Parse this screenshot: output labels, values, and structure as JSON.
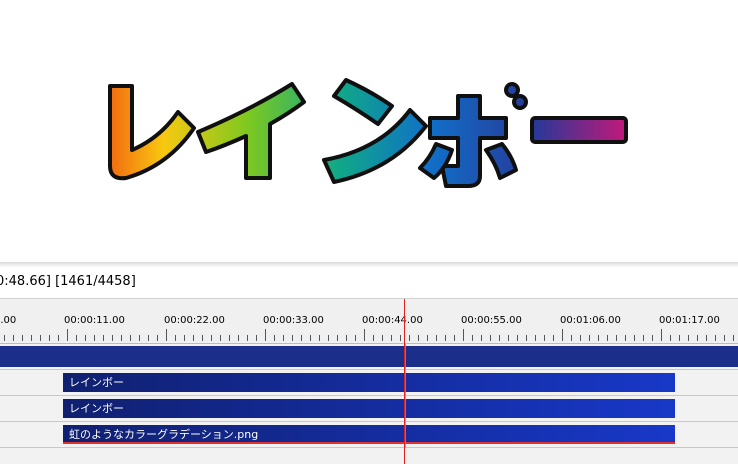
{
  "preview": {
    "text": "レインボー",
    "gradient": [
      "#f06010",
      "#f8d010",
      "#60c020",
      "#10a090",
      "#1060c8",
      "#283898",
      "#c01878"
    ]
  },
  "status": {
    "text": "0:48.66] [1461/4458]"
  },
  "ruler": {
    "labels": [
      "0.00",
      "00:00:11.00",
      "00:00:22.00",
      "00:00:33.00",
      "00:00:44.00",
      "00:00:55.00",
      "00:01:06.00",
      "00:01:17.00"
    ]
  },
  "layers": {
    "clip1": "レインボー",
    "clip2": "レインボー",
    "clip3": "虹のようなカラーグラデーション.png"
  },
  "colors": {
    "clip_dark": "#102070",
    "clip_light": "#1838c8",
    "cursor": "#e02020"
  }
}
